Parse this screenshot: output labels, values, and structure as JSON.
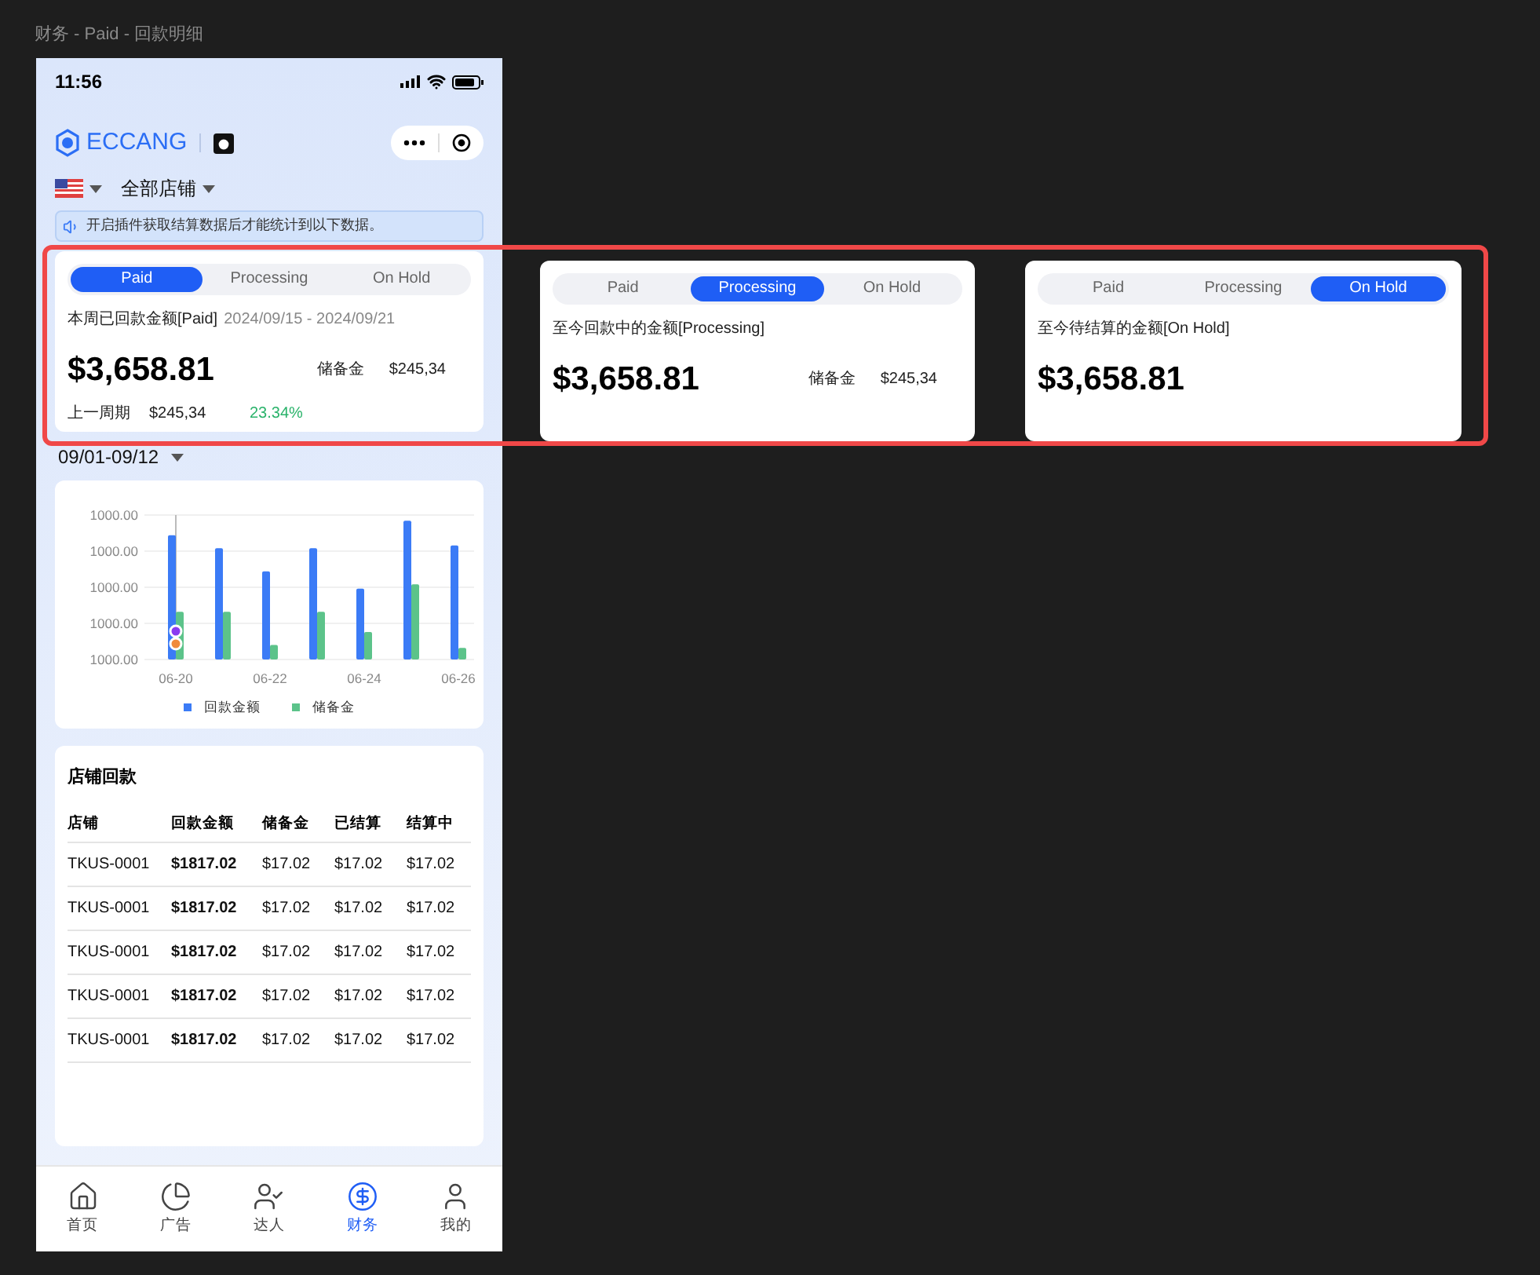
{
  "page_title": "财务 - Paid - 回款明细",
  "status_bar": {
    "time": "11:56"
  },
  "header": {
    "brand": "ECCANG"
  },
  "store_filter": {
    "label": "全部店铺"
  },
  "notice": "开启插件获取结算数据后才能统计到以下数据。",
  "summary_cards": [
    {
      "tabs": [
        {
          "label": "Paid",
          "selected": true
        },
        {
          "label": "Processing",
          "selected": false
        },
        {
          "label": "On Hold",
          "selected": false
        }
      ],
      "title": "本周已回款金额[Paid]",
      "date_range": "2024/09/15 - 2024/09/21",
      "amount": "$3,658.81",
      "reserve_label": "储备金",
      "reserve_value": "$245,34",
      "previous_label": "上一周期",
      "previous_value": "$245,34",
      "change": "23.34%"
    },
    {
      "tabs": [
        {
          "label": "Paid",
          "selected": false
        },
        {
          "label": "Processing",
          "selected": true
        },
        {
          "label": "On Hold",
          "selected": false
        }
      ],
      "title": "至今回款中的金额[Processing]",
      "amount": "$3,658.81",
      "reserve_label": "储备金",
      "reserve_value": "$245,34"
    },
    {
      "tabs": [
        {
          "label": "Paid",
          "selected": false
        },
        {
          "label": "Processing",
          "selected": false
        },
        {
          "label": "On Hold",
          "selected": true
        }
      ],
      "title": "至今待结算的金额[On Hold]",
      "amount": "$3,658.81"
    }
  ],
  "period": "09/01-09/12",
  "chart": {
    "y_labels": [
      "1000.00",
      "1000.00",
      "1000.00",
      "1000.00",
      "1000.00"
    ],
    "x_labels": [
      "06-20",
      "06-22",
      "06-24",
      "06-26"
    ],
    "legend": [
      {
        "label": "回款金额",
        "color": "#3b7bf6"
      },
      {
        "label": "储备金",
        "color": "#5cc38a"
      }
    ]
  },
  "table": {
    "title": "店铺回款",
    "columns": [
      "店铺",
      "回款金额",
      "储备金",
      "已结算",
      "结算中"
    ],
    "rows": [
      [
        "TKUS-0001",
        "$1817.02",
        "$17.02",
        "$17.02",
        "$17.02"
      ],
      [
        "TKUS-0001",
        "$1817.02",
        "$17.02",
        "$17.02",
        "$17.02"
      ],
      [
        "TKUS-0001",
        "$1817.02",
        "$17.02",
        "$17.02",
        "$17.02"
      ],
      [
        "TKUS-0001",
        "$1817.02",
        "$17.02",
        "$17.02",
        "$17.02"
      ],
      [
        "TKUS-0001",
        "$1817.02",
        "$17.02",
        "$17.02",
        "$17.02"
      ]
    ]
  },
  "tab_bar": [
    {
      "label": "首页",
      "selected": false
    },
    {
      "label": "广告",
      "selected": false
    },
    {
      "label": "达人",
      "selected": false
    },
    {
      "label": "财务",
      "selected": true
    },
    {
      "label": "我的",
      "selected": false
    }
  ]
}
